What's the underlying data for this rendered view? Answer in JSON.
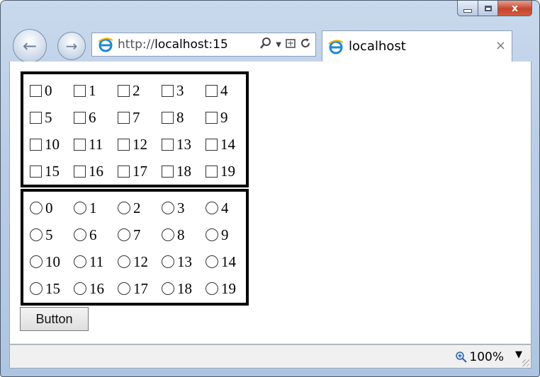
{
  "browser": {
    "url_prefix": "http://",
    "url_host": "localhost:15",
    "tab_title": "localhost",
    "tab_close": "×",
    "window_close": "x",
    "zoom_level": "100%"
  },
  "checkbox_group": {
    "labels": [
      "0",
      "1",
      "2",
      "3",
      "4",
      "5",
      "6",
      "7",
      "8",
      "9",
      "10",
      "11",
      "12",
      "13",
      "14",
      "15",
      "16",
      "17",
      "18",
      "19"
    ]
  },
  "radio_group": {
    "labels": [
      "0",
      "1",
      "2",
      "3",
      "4",
      "5",
      "6",
      "7",
      "8",
      "9",
      "10",
      "11",
      "12",
      "13",
      "14",
      "15",
      "16",
      "17",
      "18",
      "19"
    ]
  },
  "button": {
    "label": "Button"
  }
}
